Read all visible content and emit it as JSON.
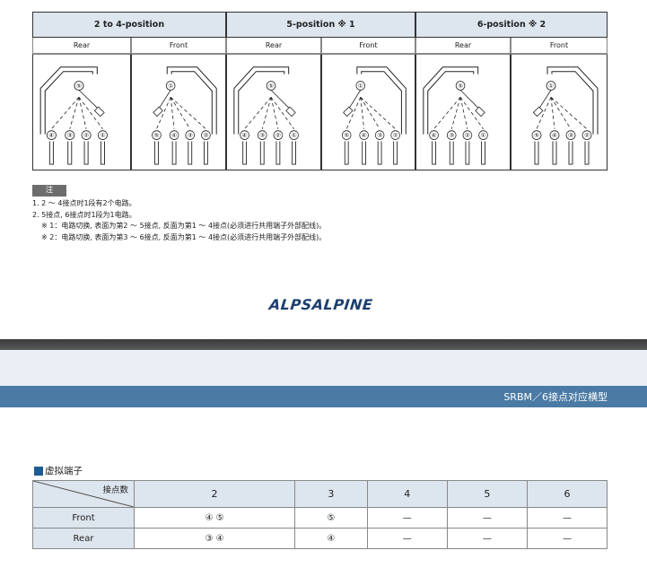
{
  "diagram_table": {
    "groups": [
      {
        "label": "2 to 4-position"
      },
      {
        "label": "5-position ※ 1"
      },
      {
        "label": "6-position ※ 2"
      }
    ],
    "sub_headers": [
      "Rear",
      "Front",
      "Rear",
      "Front",
      "Rear",
      "Front"
    ],
    "panels": [
      {
        "side": "Rear",
        "common": "⑤",
        "terminals": [
          "④",
          "③",
          "②",
          "①"
        ]
      },
      {
        "side": "Front",
        "common": "①",
        "terminals": [
          "⑤",
          "④",
          "③",
          "②"
        ]
      },
      {
        "side": "Rear",
        "common": "⑤",
        "terminals": [
          "④",
          "③",
          "②",
          "①"
        ]
      },
      {
        "side": "Front",
        "common": "①",
        "terminals": [
          "⑤",
          "④",
          "③",
          "②"
        ]
      },
      {
        "side": "Rear",
        "common": "⑤",
        "terminals": [
          "④",
          "③",
          "②",
          "①"
        ]
      },
      {
        "side": "Front",
        "common": "①",
        "terminals": [
          "⑤",
          "④",
          "③",
          "②"
        ]
      }
    ]
  },
  "notes": {
    "tag": "注",
    "lines": [
      "1. 2 ～ 4接点时1段有2个电路。",
      "2. 5接点, 6接点时1段为1电路。",
      "※ 1：电路切换, 表面为第2 ～ 5接点, 反面为第1 ～ 4接点(必须进行共用端子外部配线)。",
      "※ 2：电路切换, 表面为第3 ～ 6接点, 反面为第1 ～ 4接点(必须进行共用端子外部配线)。"
    ]
  },
  "brand": {
    "logo_text": "ALPSALPINE"
  },
  "title_bar": {
    "text": "SRBM／6接点对应横型"
  },
  "section": {
    "heading": "虚拟端子"
  },
  "terminal_table": {
    "corner_label": "接点数",
    "columns": [
      "2",
      "3",
      "4",
      "5",
      "6"
    ],
    "rows": [
      {
        "label": "Front",
        "cells": [
          "④ ⑤",
          "⑤",
          "—",
          "—",
          "—"
        ]
      },
      {
        "label": "Rear",
        "cells": [
          "③ ④",
          "④",
          "—",
          "—",
          "—"
        ]
      }
    ]
  }
}
